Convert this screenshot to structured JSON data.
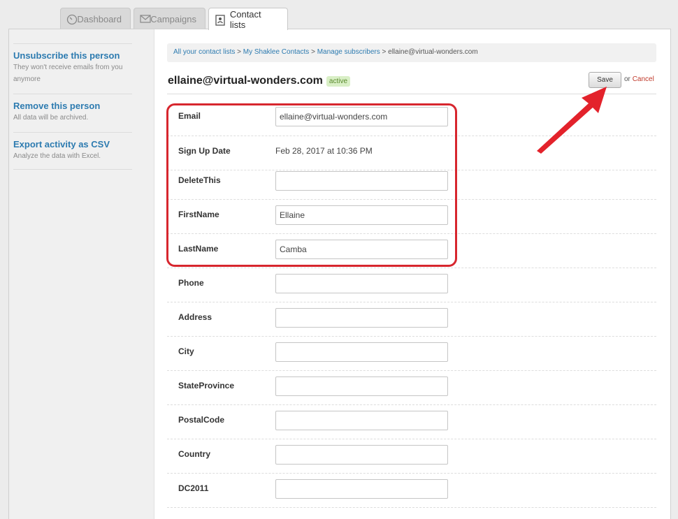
{
  "tabs": [
    {
      "label": "Dashboard",
      "icon": "gauge-icon"
    },
    {
      "label": "Campaigns",
      "icon": "envelope-icon"
    },
    {
      "label": "Contact lists",
      "icon": "contact-card-icon"
    }
  ],
  "sidebar": {
    "items": [
      {
        "title": "Unsubscribe this person",
        "desc": "They won't receive emails from you anymore"
      },
      {
        "title": "Remove this person",
        "desc": "All data will be archived."
      },
      {
        "title": "Export activity as CSV",
        "desc": "Analyze the data with Excel."
      }
    ]
  },
  "breadcrumb": {
    "links": [
      "All your contact lists",
      "My Shaklee Contacts",
      "Manage subscribers"
    ],
    "separator": ">",
    "current": "ellaine@virtual-wonders.com"
  },
  "subscriber": {
    "email": "ellaine@virtual-wonders.com",
    "status": "active"
  },
  "actions": {
    "save_label": "Save",
    "or_text": "or",
    "cancel_label": "Cancel"
  },
  "fields": [
    {
      "label": "Email",
      "type": "input",
      "value": "ellaine@virtual-wonders.com"
    },
    {
      "label": "Sign Up Date",
      "type": "text",
      "value": "Feb 28, 2017 at 10:36 PM"
    },
    {
      "label": "DeleteThis",
      "type": "input",
      "value": ""
    },
    {
      "label": "FirstName",
      "type": "input",
      "value": "Ellaine"
    },
    {
      "label": "LastName",
      "type": "input",
      "value": "Camba"
    },
    {
      "label": "Phone",
      "type": "input",
      "value": ""
    },
    {
      "label": "Address",
      "type": "input",
      "value": ""
    },
    {
      "label": "City",
      "type": "input",
      "value": ""
    },
    {
      "label": "StateProvince",
      "type": "input",
      "value": ""
    },
    {
      "label": "PostalCode",
      "type": "input",
      "value": ""
    },
    {
      "label": "Country",
      "type": "input",
      "value": ""
    },
    {
      "label": "DC2011",
      "type": "input",
      "value": ""
    }
  ],
  "colors": {
    "link": "#2d7bb0",
    "highlight": "#d7262e",
    "badge_bg": "#d9efc6"
  }
}
